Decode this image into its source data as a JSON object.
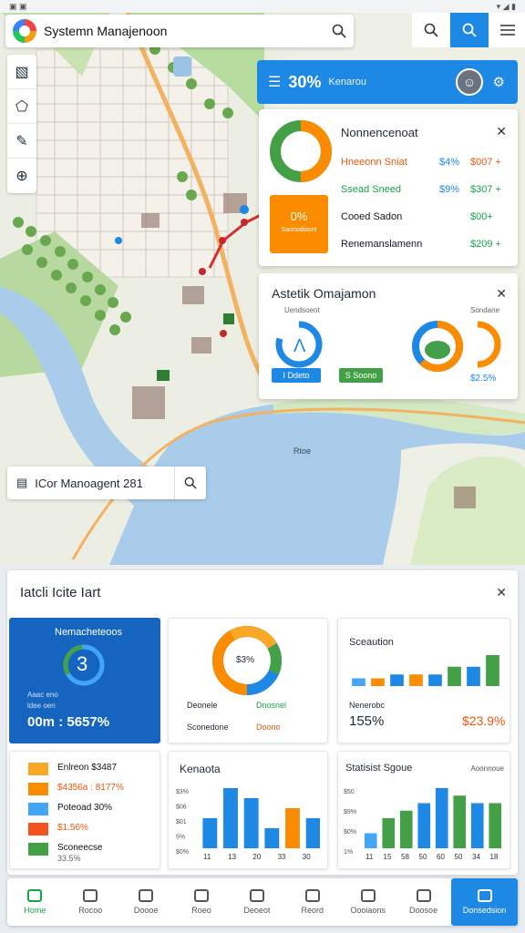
{
  "app": {
    "title": "Systemn Manajenoon"
  },
  "header": {
    "value": "30%",
    "sub": "Kenarou"
  },
  "card1": {
    "title": "Nonnencenoat",
    "rows": [
      {
        "label": "Hneeonn Sniat",
        "a": "$4%",
        "b": "$007 +",
        "color": "#ea580c"
      },
      {
        "label": "Ssead Sneed",
        "a": "$9%",
        "b": "$307 +",
        "color": "#16a34a"
      },
      {
        "label": "Cooed Sadon",
        "a": "",
        "b": "$00+",
        "color": "#111827"
      },
      {
        "label": "Renemanslamenn",
        "a": "",
        "b": "$209 +",
        "color": "#111827"
      }
    ],
    "box_value": "0%",
    "box_label": "Saonodiasnt"
  },
  "card2": {
    "title": "Astetik Omajamon",
    "label1": "Uendsoeot",
    "label2": "Sondane",
    "btn1": "I Ddeto",
    "btn2": "S Soono",
    "pct": "$2.5%",
    "chart_data": {
      "type": "pie",
      "values": [
        62,
        38
      ]
    }
  },
  "map": {
    "search_label": "ICor Manoagent 281",
    "lake": "Rtoe"
  },
  "panel": {
    "title": "Iatcli Icite Iart",
    "tile1": {
      "title": "Nemacheteoos",
      "ring": "3",
      "line1": "Aaac eno",
      "line2": "ldee oen",
      "value": "00m : 5657%"
    },
    "tile2": {
      "center": "$3%",
      "l1": "Deonele",
      "l2": "Dnosnel",
      "l3": "Sconedone",
      "l4": "Doono"
    },
    "tile3": {
      "title": "Sceaution",
      "label": "Nenerobc",
      "value": "155%",
      "value2": "$23.9%",
      "chart_data": {
        "type": "bar",
        "values": [
          2,
          2,
          3,
          3,
          3,
          5,
          5,
          8
        ],
        "colors": [
          "#42a5f5",
          "#fb8c00",
          "#1e88e5",
          "#fb8c00",
          "#1e88e5",
          "#43a047",
          "#1e88e5",
          "#43a047"
        ]
      }
    },
    "tile4": {
      "items": [
        {
          "label": "Enlreon $3487",
          "color": "#f9a825"
        },
        {
          "label": "$4356a : 8177%",
          "color": "#fb8c00"
        },
        {
          "label": "Poteoad 30%",
          "color": "#42a5f5"
        },
        {
          "label": "$1.56%",
          "color": "#f4511e"
        },
        {
          "label": "Sconeecse",
          "sub": "33.5%",
          "color": "#43a047"
        }
      ]
    },
    "tile5": {
      "title": "Kenaota",
      "yticks": [
        "$3%",
        "$06",
        "$01",
        "5%",
        "$0%"
      ],
      "xticks": [
        "11",
        "13",
        "20",
        "33",
        "30"
      ],
      "chart_data": {
        "type": "bar",
        "values": [
          3,
          6,
          5,
          2,
          4,
          3
        ],
        "colors": [
          "#1e88e5",
          "#1e88e5",
          "#1e88e5",
          "#1e88e5",
          "#fb8c00",
          "#1e88e5"
        ]
      }
    },
    "tile6": {
      "title": "Statisist Sgoue",
      "right": "Aoonnoue",
      "yticks": [
        "$50",
        "$9%",
        "$0%",
        "1%"
      ],
      "xticks": [
        "11",
        "15",
        "58",
        "50",
        "60",
        "50",
        "34",
        "18"
      ],
      "chart_data": {
        "type": "bar",
        "values": [
          2,
          4,
          5,
          6,
          8,
          7,
          6,
          6
        ],
        "colors": [
          "#42a5f5",
          "#43a047",
          "#43a047",
          "#1e88e5",
          "#1e88e5",
          "#43a047",
          "#1e88e5",
          "#43a047"
        ]
      }
    }
  },
  "nav": [
    {
      "label": "Home"
    },
    {
      "label": "Rocoo"
    },
    {
      "label": "Doooe"
    },
    {
      "label": "Roeo"
    },
    {
      "label": "Deoeot"
    },
    {
      "label": "Reord"
    },
    {
      "label": "Oooiaons"
    },
    {
      "label": "Doosoe"
    },
    {
      "label": "Donsedsion"
    }
  ]
}
